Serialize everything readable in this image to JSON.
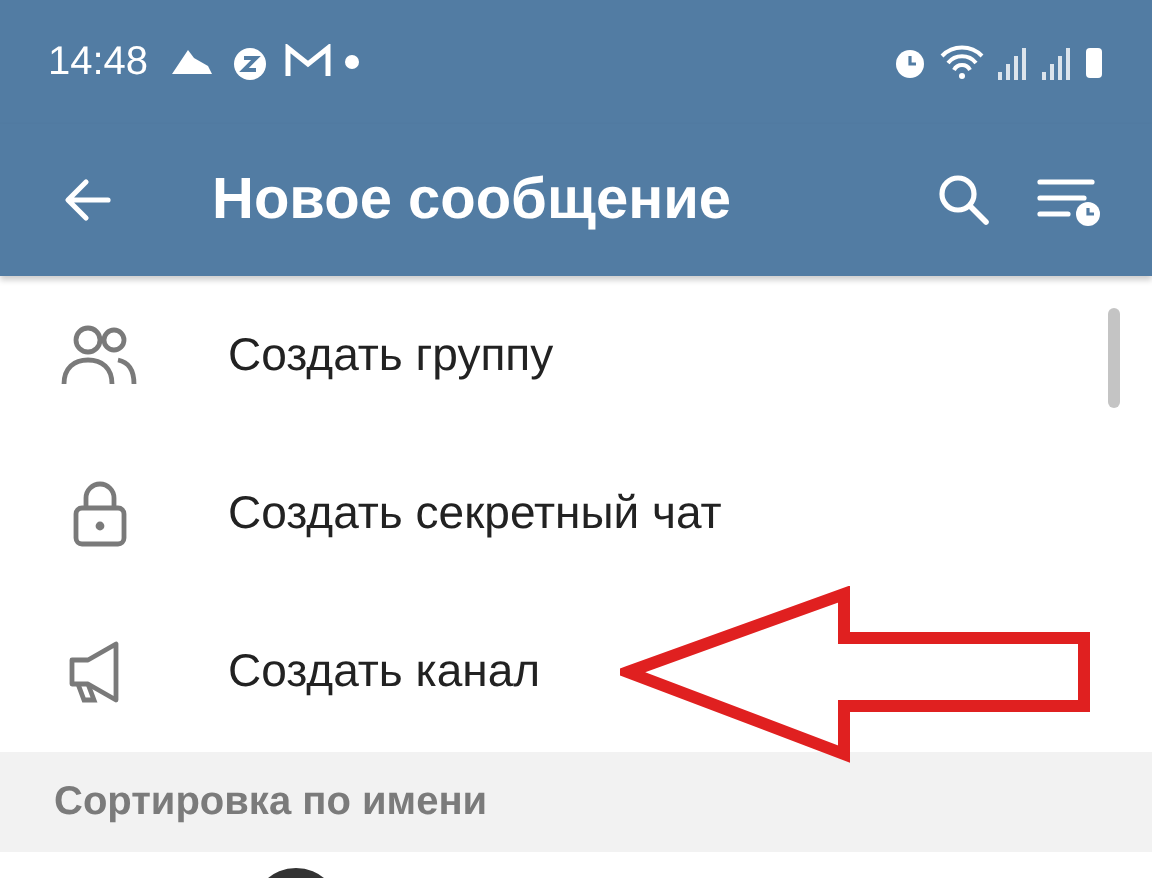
{
  "status_bar": {
    "time": "14:48"
  },
  "header": {
    "title": "Новое сообщение"
  },
  "menu_items": [
    {
      "kind": "group",
      "label": "Создать группу"
    },
    {
      "kind": "lock",
      "label": "Создать секретный чат"
    },
    {
      "kind": "megaphone",
      "label": "Создать канал"
    }
  ],
  "section_header": "Сортировка по имени"
}
